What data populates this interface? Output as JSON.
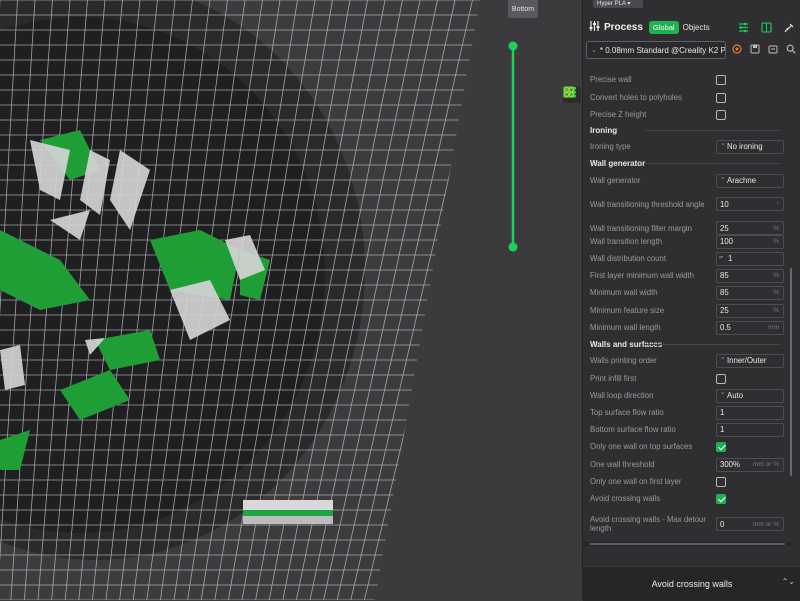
{
  "viewport": {
    "view_button": "Bottom",
    "layer_slider_color": "#1fcf5e"
  },
  "panel": {
    "filament_tab": "Hyper PLA ▾",
    "process_title": "Process",
    "global_label": "Global",
    "objects_label": "Objects",
    "preset": "* 0.08mm Standard @Creality K2 Plu...",
    "accent": "#1fb052"
  },
  "settings": [
    {
      "type": "checkbox",
      "label": "Precise wall",
      "checked": false
    },
    {
      "type": "checkbox",
      "label": "Convert holes to polyholes",
      "checked": false
    },
    {
      "type": "checkbox",
      "label": "Precise Z height",
      "checked": false
    },
    {
      "type": "section",
      "label": "Ironing"
    },
    {
      "type": "select",
      "label": "Ironing type",
      "value": "No ironing"
    },
    {
      "type": "section",
      "label": "Wall generator"
    },
    {
      "type": "select",
      "label": "Wall generator",
      "value": "Arachne"
    },
    {
      "type": "input",
      "label": "Wall transitioning threshold angle",
      "value": "10",
      "unit": "°"
    },
    {
      "type": "input",
      "label": "Wall transitioning filter margin",
      "value": "25",
      "unit": "%"
    },
    {
      "type": "input",
      "label": "Wall transition length",
      "value": "100",
      "unit": "%"
    },
    {
      "type": "spin",
      "label": "Wall distribution count",
      "value": "1"
    },
    {
      "type": "input",
      "label": "First layer minimum wall width",
      "value": "85",
      "unit": "%"
    },
    {
      "type": "input",
      "label": "Minimum wall width",
      "value": "85",
      "unit": "%"
    },
    {
      "type": "input",
      "label": "Minimum feature size",
      "value": "25",
      "unit": "%"
    },
    {
      "type": "input",
      "label": "Minimum wall length",
      "value": "0.5",
      "unit": "mm"
    },
    {
      "type": "section",
      "label": "Walls and surfaces"
    },
    {
      "type": "select",
      "label": "Walls printing order",
      "value": "Inner/Outer"
    },
    {
      "type": "checkbox",
      "label": "Print infill first",
      "checked": false
    },
    {
      "type": "select",
      "label": "Wall loop direction",
      "value": "Auto"
    },
    {
      "type": "input",
      "label": "Top surface flow ratio",
      "value": "1",
      "unit": ""
    },
    {
      "type": "input",
      "label": "Bottom surface flow ratio",
      "value": "1",
      "unit": ""
    },
    {
      "type": "checkbox",
      "label": "Only one wall on top surfaces",
      "checked": true
    },
    {
      "type": "input",
      "label": "One wall threshold",
      "value": "300%",
      "unit": "mm or %"
    },
    {
      "type": "checkbox",
      "label": "Only one wall on first layer",
      "checked": false
    },
    {
      "type": "checkbox",
      "label": "Avoid crossing walls",
      "checked": true
    },
    {
      "type": "input",
      "label": "Avoid crossing walls - Max detour length",
      "value": "0",
      "unit": "mm or %"
    }
  ],
  "footer": {
    "help_title": "Avoid crossing walls"
  }
}
